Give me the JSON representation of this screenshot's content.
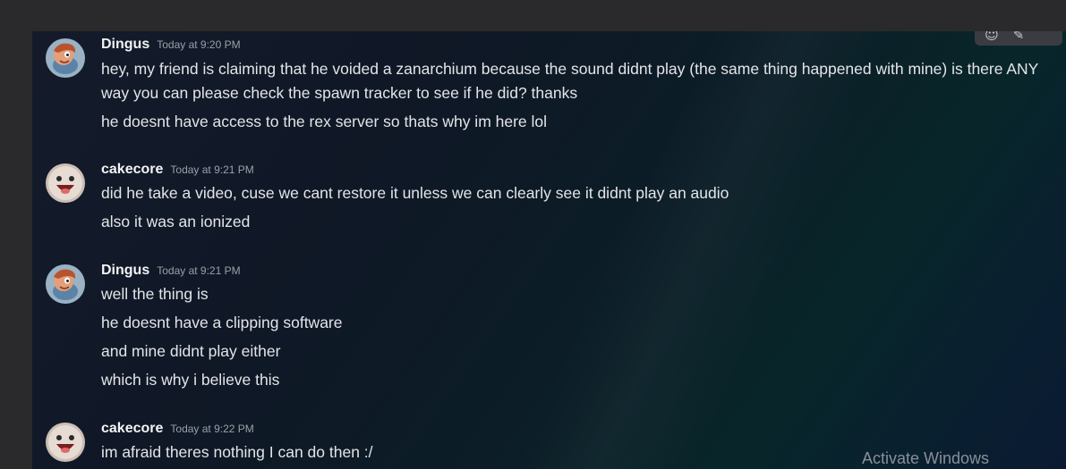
{
  "messages": [
    {
      "author": "Dingus",
      "timestamp": "Today at 9:20 PM",
      "avatar": "cartoon-face-avatar",
      "lines": [
        "hey, my friend is claiming that he voided a zanarchium because the sound didnt play (the same thing happened with mine) is there ANY way you can please check the spawn tracker to see if he did? thanks",
        "he doesnt have access to the rex server so thats why im here lol"
      ]
    },
    {
      "author": "cakecore",
      "timestamp": "Today at 9:21 PM",
      "avatar": "smiley-face-avatar",
      "lines": [
        "did he take a video, cuse we cant restore it unless we can clearly see it didnt play an audio",
        "also it was an ionized"
      ]
    },
    {
      "author": "Dingus",
      "timestamp": "Today at 9:21 PM",
      "avatar": "cartoon-face-avatar",
      "lines": [
        "well the thing is",
        "he doesnt have a clipping software",
        "and mine didnt play either",
        "which is why i believe this"
      ]
    },
    {
      "author": "cakecore",
      "timestamp": "Today at 9:22 PM",
      "avatar": "smiley-face-avatar",
      "lines": [
        "im afraid theres nothing I can do then :/"
      ]
    }
  ],
  "toolbar": {
    "icons": [
      "add-reaction-icon",
      "edit-icon"
    ]
  },
  "watermark": "Activate Windows",
  "colors": {
    "background": "#0d1a28",
    "username": "#f2f3f5",
    "text": "#e3e5e8",
    "timestamp": "#9aa0a8"
  }
}
